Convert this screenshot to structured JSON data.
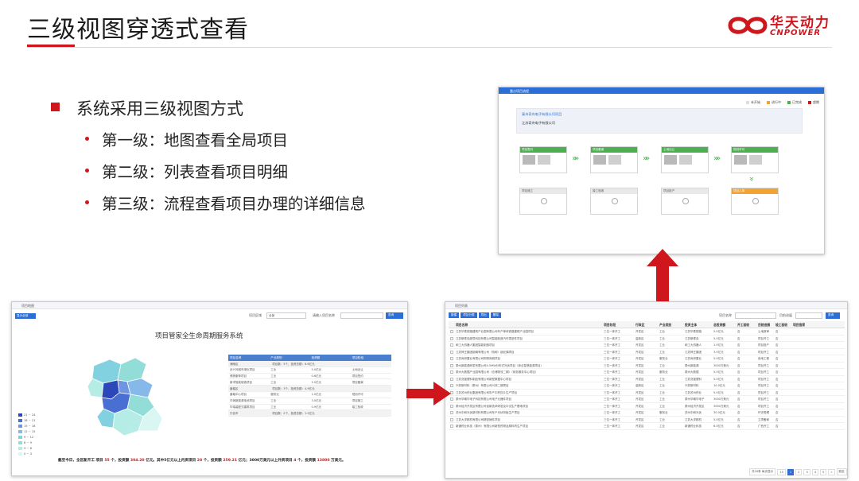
{
  "slide": {
    "title": "三级视图穿透式查看",
    "logo_cn": "华天动力",
    "logo_en": "CNPOWER",
    "bullet_main": "系统采用三级视图方式",
    "bullets": [
      "第一级：地图查看全局项目",
      "第二级：列表查看项目明细",
      "第三级：流程查看项目办理的详细信息"
    ],
    "colors": {
      "accent": "#d0161d",
      "ui_blue": "#2b6fd6",
      "stage_done": "#4caf50",
      "stage_active": "#f3a331"
    }
  },
  "detail_view": {
    "header": "重点项目流程",
    "legend": [
      "未开始",
      "进行中",
      "已完成",
      "超期"
    ],
    "project_name": "泰州奇舟电子有限公司项目",
    "company": "江苏奇舟电子有限公司",
    "stages_top": [
      "项目签约",
      "项目备案",
      "土地出让",
      "规划许可"
    ],
    "stages_bottom": [
      "项目施工",
      "竣工验收",
      "项目投产",
      "项目入库"
    ]
  },
  "map_view": {
    "bar_title": "项目地图",
    "back_button": "显示全部",
    "filter_area_label": "项目区域",
    "filter_area_value": "全部",
    "filter_name_placeholder": "请输入项目名称",
    "search_button": "查询",
    "title": "项目管家全生命周期服务系统",
    "legend": [
      {
        "label": "21 ~ 24",
        "color": "#2b47b8"
      },
      {
        "label": "18 ~ 21",
        "color": "#4a6fd2"
      },
      {
        "label": "15 ~ 18",
        "color": "#6f94e0"
      },
      {
        "label": "12 ~ 15",
        "color": "#86b8ea"
      },
      {
        "label": "9 ~ 12",
        "color": "#82d1e0"
      },
      {
        "label": "6 ~ 9",
        "color": "#93ddd9"
      },
      {
        "label": "3 ~ 6",
        "color": "#b5ece6"
      },
      {
        "label": "0 ~ 3",
        "color": "#d9f6f2"
      }
    ],
    "table_headers": [
      "项目名称",
      "产业类别",
      "投资额",
      "项目阶段"
    ],
    "table_rows": [
      {
        "group": true,
        "cells": [
          "海陵区",
          "项目数：5个，投资总额：6.6亿元",
          "",
          ""
        ]
      },
      {
        "group": false,
        "cells": [
          "永兴河城市绿化项目",
          "工业",
          "5.0亿元",
          "土地出让"
        ]
      },
      {
        "group": false,
        "cells": [
          "博扬服饰项目",
          "工业",
          "0.6亿元",
          "项目签约"
        ]
      },
      {
        "group": false,
        "cells": [
          "新洋智能制造项目",
          "工业",
          "1.0亿元",
          "项目备案"
        ]
      },
      {
        "group": true,
        "cells": [
          "姜堰区",
          "项目数：3个，投资总额：4.9亿元",
          "",
          ""
        ]
      },
      {
        "group": false,
        "cells": [
          "姜堰中心项目",
          "服务业",
          "1.0亿元",
          "规划许可"
        ]
      },
      {
        "group": false,
        "cells": [
          "华润新能源电池项目",
          "工业",
          "3.0亿元",
          "项目施工"
        ]
      },
      {
        "group": false,
        "cells": [
          "华瑞装配式建筑项目",
          "工业",
          "0.9亿元",
          "竣工验收"
        ]
      },
      {
        "group": true,
        "cells": [
          "兴化市",
          "项目数：2个，投资总额：1.5亿元",
          "",
          ""
        ]
      }
    ],
    "footer_parts": [
      {
        "t": "截至今日，全区新开工 项目 ",
        "red": false
      },
      {
        "t": "55",
        "red": true
      },
      {
        "t": " 个，投资额 ",
        "red": false
      },
      {
        "t": "304.20",
        "red": true
      },
      {
        "t": " 亿元。其中5亿元以上内资项目 ",
        "red": false
      },
      {
        "t": "28",
        "red": true
      },
      {
        "t": " 个，投资额 ",
        "red": false
      },
      {
        "t": "259.21",
        "red": true
      },
      {
        "t": " 亿元；3000万美元以上外资项目 ",
        "red": false
      },
      {
        "t": "4",
        "red": true
      },
      {
        "t": " 个，投资额 ",
        "red": false
      },
      {
        "t": "13800",
        "red": true
      },
      {
        "t": " 万美元。",
        "red": false
      }
    ]
  },
  "list_view": {
    "bar_title": "项目列表",
    "buttons": [
      "新建",
      "项目分类",
      "导出",
      "删除"
    ],
    "filter_name_label": "项目名称",
    "filter_area_label": "目前进展",
    "search_button": "查询",
    "headers": [
      "",
      "项目名称",
      "项目阶段",
      "行政区",
      "产业类别",
      "投资主体",
      "总投资额",
      "开工验收",
      "目前进展",
      "竣工验收",
      "项目管家"
    ],
    "rows": [
      [
        "江苏华泰铁路建筑产业园有限公司年产单体铁路建筑产业园项目",
        "三位一体开工",
        "开发区",
        "工业",
        "江苏华泰铁路",
        "5.0亿元",
        "否",
        "土地报审",
        "否",
        ""
      ],
      [
        "江苏斯泰克超导科技有限公司智能制造汽车零部件项目",
        "三位一体开工",
        "高新区",
        "工业",
        "江苏斯泰克",
        "5.0亿元",
        "否",
        "项目开工",
        "否",
        ""
      ],
      [
        "和工大机器人集团智能制造项目",
        "三位一体开工",
        "开发区",
        "工业",
        "和工大机器人",
        "1.0亿元",
        "否",
        "项目投产",
        "否",
        ""
      ],
      [
        "江苏神王集团钢绳有限公司（特种）钢丝绳项目",
        "三位一体开工",
        "开发区",
        "工业",
        "江苏神王集团",
        "3.0亿元",
        "否",
        "项目开工",
        "否",
        ""
      ],
      [
        "江苏尚邦置业有限公司购物商城项目",
        "三位一体开工",
        "开发区",
        "服务业",
        "江苏尚邦置业",
        "5.0亿元",
        "否",
        "用地工程",
        "否",
        ""
      ],
      [
        "泰州新能源研发有限公司4.5MW分布式光伏项目（综合智慧能源项目）",
        "三位一体开工",
        "开发区",
        "工业",
        "泰州新能源",
        "3000万美元",
        "否",
        "项目开工",
        "否",
        ""
      ],
      [
        "泰州大数据产业园有限公司（仓储物流二期）（商务服务中心项目）",
        "三位一体开工",
        "开发区",
        "服务业",
        "泰州大数据",
        "5.0亿元",
        "否",
        "项目开工",
        "否",
        ""
      ],
      [
        "江苏亚普塑料制品有限公司新型数据中心项目",
        "三位一体开工",
        "开发区",
        "工业",
        "江苏亚普塑料",
        "5.0亿元",
        "否",
        "项目开工",
        "否",
        ""
      ],
      [
        "兴邦新材料（泰州）有限公司兴邦二期项目",
        "三位一体开工",
        "高新区",
        "工业",
        "兴邦新材料",
        "10.0亿元",
        "否",
        "项目开工",
        "否",
        ""
      ],
      [
        "江苏苏州药业集团有限公司年产中药饮片生产项目",
        "三位一体开工",
        "开发区",
        "工业",
        "江苏苏州药业",
        "5.0亿元",
        "否",
        "项目开工",
        "否",
        ""
      ],
      [
        "泰州华曦华电子科技有限公司电子元器件项目",
        "三位一体开工",
        "开发区",
        "工业",
        "泰州华曦华电子",
        "3000万美元",
        "否",
        "项目开工",
        "否",
        ""
      ],
      [
        "泰州经济开发区有限公司创新技术研发及中试生产基地项目",
        "三位一体开工",
        "开发区",
        "工业",
        "泰州经济开发区",
        "3000万美元",
        "否",
        "项目开工",
        "否",
        ""
      ],
      [
        "苏州中和光伏新材料有限公司年产光伏背板生产项目",
        "三位一体开工",
        "开发区",
        "服务业",
        "苏州中和光伏",
        "30.0亿元",
        "否",
        "环评受理",
        "否",
        ""
      ],
      [
        "江苏大洋精机有限公司精密铸件项目",
        "三位一体开工",
        "开发区",
        "工业",
        "江苏大洋精机",
        "5.0亿元",
        "否",
        "立项备案",
        "否",
        ""
      ],
      [
        "新通药业科技（泰州）有限公司新型药物及原料药生产项目",
        "三位一体开工",
        "开发区",
        "工业",
        "新通药业科技",
        "6.0亿元",
        "否",
        "广西开工",
        "否",
        ""
      ]
    ],
    "pager": [
      "共16条  每页显示",
      "15",
      "1",
      "2",
      "3",
      "4",
      "5",
      "»",
      "跳至"
    ]
  }
}
